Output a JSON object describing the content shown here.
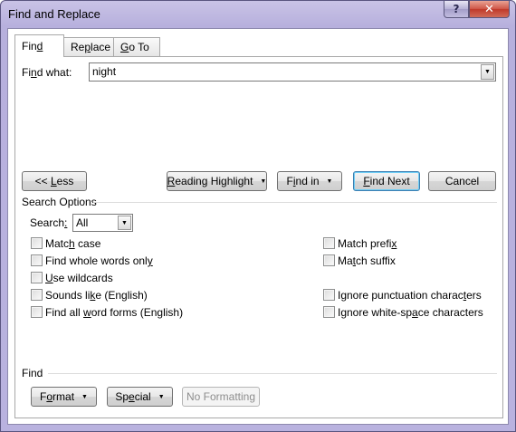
{
  "window": {
    "title": "Find and Replace",
    "help_label": "?",
    "close_label": "✕"
  },
  "tabs": [
    {
      "pre": "Fin",
      "key": "d",
      "post": ""
    },
    {
      "pre": "Re",
      "key": "p",
      "post": "lace"
    },
    {
      "pre": "",
      "key": "G",
      "post": "o To"
    }
  ],
  "find": {
    "label_pre": "Fi",
    "label_key": "n",
    "label_post": "d what:",
    "value": "night"
  },
  "buttons": {
    "less": {
      "pre": "<< ",
      "key": "L",
      "post": "ess"
    },
    "reading_highlight": {
      "pre": "",
      "key": "R",
      "post": "eading Highlight"
    },
    "find_in": {
      "pre": "F",
      "key": "i",
      "post": "nd in"
    },
    "find_next": {
      "pre": "",
      "key": "F",
      "post": "ind Next"
    },
    "cancel": "Cancel"
  },
  "search_options": {
    "heading": "Search Options",
    "search_label_pre": "Search",
    "search_label_key": ":",
    "search_value": "All",
    "left": [
      {
        "pre": "Matc",
        "key": "h",
        "post": " case"
      },
      {
        "pre": "Find whole words onl",
        "key": "y",
        "post": ""
      },
      {
        "pre": "",
        "key": "U",
        "post": "se wildcards"
      },
      {
        "pre": "Sounds li",
        "key": "k",
        "post": "e (English)"
      },
      {
        "pre": "Find all ",
        "key": "w",
        "post": "ord forms (English)"
      }
    ],
    "right": [
      {
        "pre": "Match prefi",
        "key": "x",
        "post": ""
      },
      {
        "pre": "Ma",
        "key": "t",
        "post": "ch suffix"
      },
      {
        "pre": "Ignore punctuation charac",
        "key": "t",
        "post": "ers"
      },
      {
        "pre": "Ignore white-sp",
        "key": "a",
        "post": "ce characters"
      }
    ]
  },
  "find_section": {
    "heading": "Find",
    "format": {
      "pre": "F",
      "key": "o",
      "post": "rmat"
    },
    "special": {
      "pre": "Sp",
      "key": "e",
      "post": "cial"
    },
    "no_formatting": "No Formatting"
  }
}
